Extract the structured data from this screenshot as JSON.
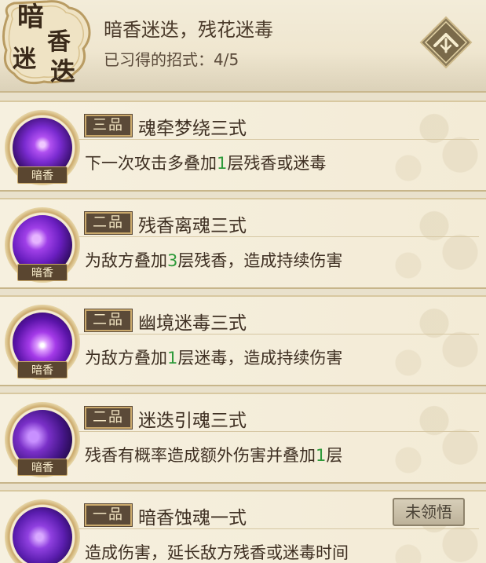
{
  "header": {
    "seal_chars": [
      "暗",
      "香",
      "迷",
      "迭"
    ],
    "title": "暗香迷迭，残花迷毒",
    "learned_label": "已习得的招式：4/5"
  },
  "skills": [
    {
      "grade": "三品",
      "name": "魂牵梦绕三式",
      "desc_pre": "下一次攻击多叠加",
      "desc_num": "1",
      "desc_post": "层残香或迷毒",
      "icon_label": "暗香",
      "icon_color": "#7a2bd0"
    },
    {
      "grade": "二品",
      "name": "残香离魂三式",
      "desc_pre": "为敌方叠加",
      "desc_num": "3",
      "desc_post": "层残香，造成持续伤害",
      "icon_label": "暗香",
      "icon_color": "#8a2ed8"
    },
    {
      "grade": "二品",
      "name": "幽境迷毒三式",
      "desc_pre": "为敌方叠加",
      "desc_num": "1",
      "desc_post": "层迷毒，造成持续伤害",
      "icon_label": "暗香",
      "icon_color": "#9b34e0"
    },
    {
      "grade": "二品",
      "name": "迷迭引魂三式",
      "desc_pre": "残香有概率造成额外伤害并叠加",
      "desc_num": "1",
      "desc_post": "层",
      "icon_label": "暗香",
      "icon_color": "#6a2aa8"
    },
    {
      "grade": "一品",
      "name": "暗香蚀魂一式",
      "desc_pre": "造成伤害，延长敌方残香或迷毒时间",
      "desc_num": "",
      "desc_post": "",
      "icon_label": "",
      "icon_color": "#7a3ad0",
      "button": "未领悟"
    }
  ],
  "colors": {
    "accent_green": "#2e9a3a",
    "grade_bg": "#5b4a38",
    "panel": "#f3ebd6"
  }
}
